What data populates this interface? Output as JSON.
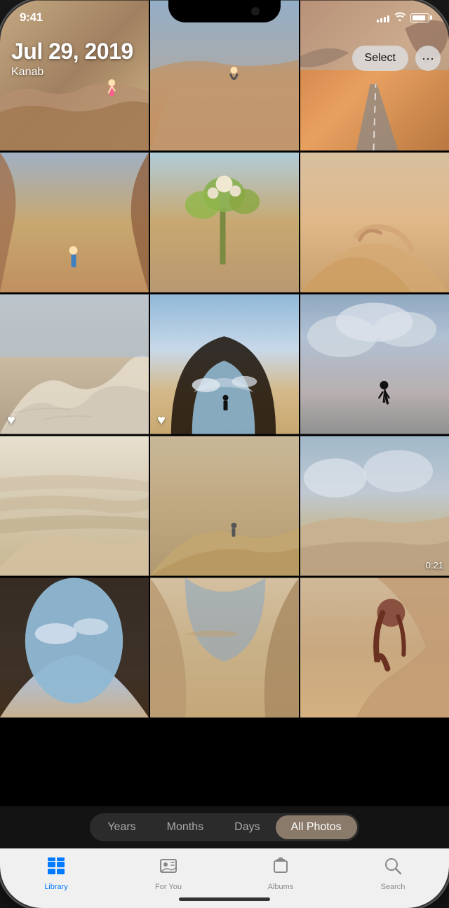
{
  "status_bar": {
    "time": "9:41",
    "signal_bars": [
      4,
      6,
      8,
      10,
      12
    ],
    "battery_level": 85
  },
  "header": {
    "date": "Jul 29, 2019",
    "location": "Kanab",
    "select_label": "Select",
    "more_label": "···"
  },
  "filter_tabs": {
    "tabs": [
      {
        "label": "Years",
        "active": false
      },
      {
        "label": "Months",
        "active": false
      },
      {
        "label": "Days",
        "active": false
      },
      {
        "label": "All Photos",
        "active": true
      }
    ]
  },
  "tab_bar": {
    "items": [
      {
        "label": "Library",
        "active": true,
        "icon": "library"
      },
      {
        "label": "For You",
        "active": false,
        "icon": "foryou"
      },
      {
        "label": "Albums",
        "active": false,
        "icon": "albums"
      },
      {
        "label": "Search",
        "active": false,
        "icon": "search"
      }
    ]
  },
  "photos": {
    "grid": [
      {
        "id": 1,
        "heart": false,
        "video": false,
        "class": "photo-1"
      },
      {
        "id": 2,
        "heart": false,
        "video": false,
        "class": "photo-2"
      },
      {
        "id": 3,
        "heart": false,
        "video": false,
        "class": "photo-3"
      },
      {
        "id": 4,
        "heart": false,
        "video": false,
        "class": "photo-4"
      },
      {
        "id": 5,
        "heart": false,
        "video": false,
        "class": "photo-5"
      },
      {
        "id": 6,
        "heart": false,
        "video": false,
        "class": "photo-6"
      },
      {
        "id": 7,
        "heart": true,
        "video": false,
        "class": "photo-7"
      },
      {
        "id": 8,
        "heart": false,
        "video": false,
        "class": "photo-8"
      },
      {
        "id": 9,
        "heart": false,
        "video": false,
        "class": "photo-9"
      },
      {
        "id": 10,
        "heart": false,
        "video": false,
        "class": "photo-10"
      },
      {
        "id": 11,
        "heart": true,
        "video": false,
        "class": "photo-11"
      },
      {
        "id": 12,
        "heart": false,
        "video": false,
        "class": "photo-12"
      },
      {
        "id": 13,
        "heart": false,
        "video": false,
        "class": "photo-13"
      },
      {
        "id": 14,
        "heart": false,
        "video": false,
        "class": "photo-14"
      },
      {
        "id": 15,
        "heart": false,
        "video": true,
        "duration": "0:21",
        "class": "photo-15"
      },
      {
        "id": 16,
        "heart": false,
        "video": false,
        "class": "photo-16"
      },
      {
        "id": 17,
        "heart": false,
        "video": false,
        "class": "photo-17"
      },
      {
        "id": 18,
        "heart": false,
        "video": false,
        "class": "photo-18"
      }
    ]
  }
}
